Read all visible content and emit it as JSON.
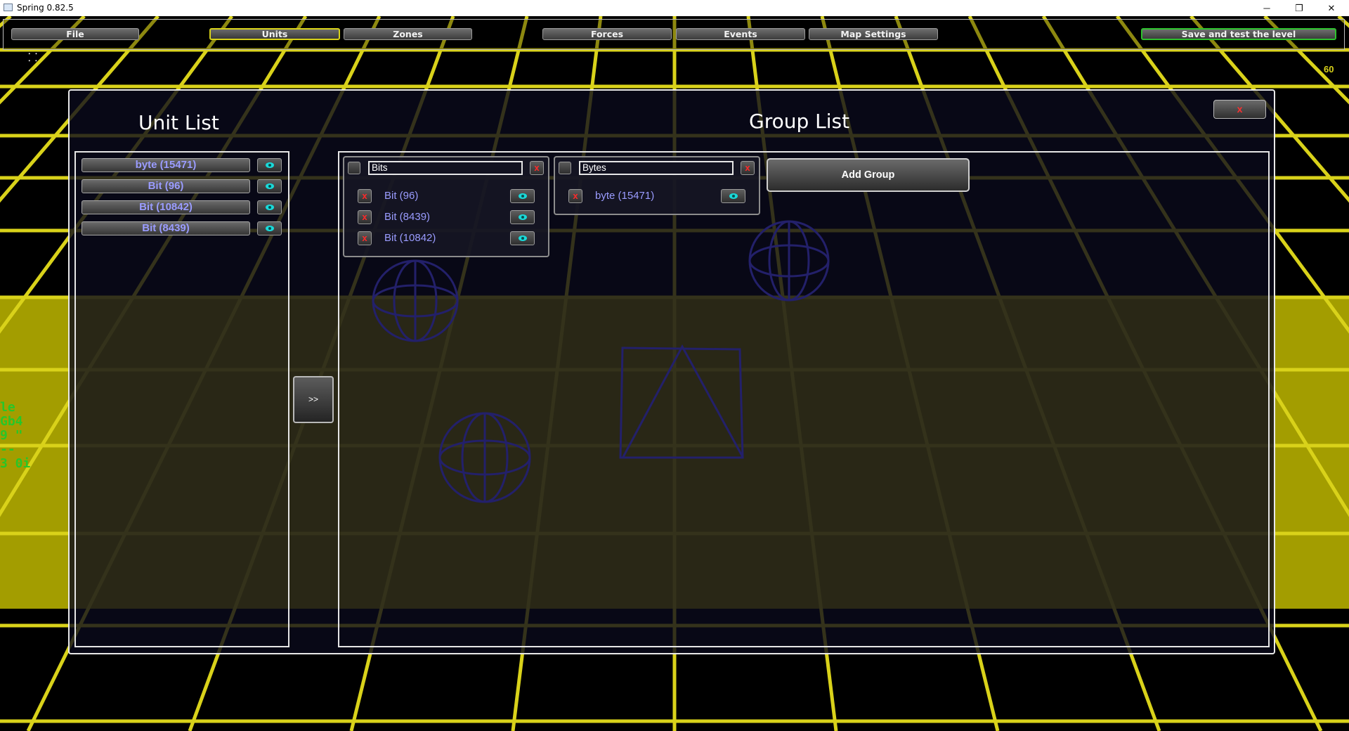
{
  "window": {
    "title": "Spring 0.82.5",
    "minimize": "─",
    "maximize": "❐",
    "close": "✕"
  },
  "menu": {
    "file": "File",
    "units": "Units",
    "zones": "Zones",
    "forces": "Forces",
    "events": "Events",
    "map_settings": "Map Settings",
    "save_test": "Save and test the level"
  },
  "fps": "60",
  "dialog": {
    "unit_list_title": "Unit List",
    "group_list_title": "Group List",
    "close_label": "x",
    "transfer_label": ">>",
    "add_group_label": "Add Group"
  },
  "unit_list": [
    {
      "label": "byte (15471)"
    },
    {
      "label": "Bit (96)"
    },
    {
      "label": "Bit (10842)"
    },
    {
      "label": "Bit (8439)"
    }
  ],
  "groups": [
    {
      "name": "Bits",
      "members": [
        "Bit (96)",
        "Bit (8439)",
        "Bit (10842)"
      ]
    },
    {
      "name": "Bytes",
      "members": [
        "byte (15471)"
      ]
    }
  ],
  "colors": {
    "grid": "#d9d21a",
    "accent_active": "#d8d21a",
    "save_border": "#2ec22e",
    "unit_text": "#9a9cff",
    "delete": "#ff2a2a",
    "eye": "#19d9d9"
  },
  "icons": {
    "remove": "x-icon",
    "visibility": "eye-icon"
  }
}
